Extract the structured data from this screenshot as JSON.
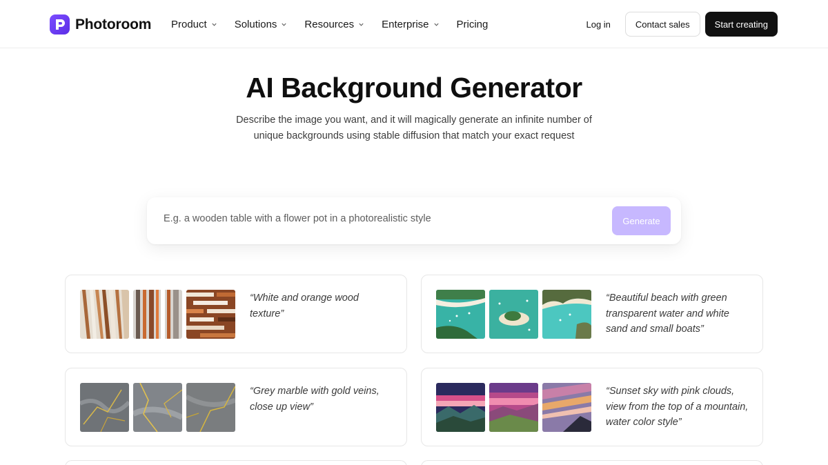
{
  "nav": {
    "brand": "Photoroom",
    "menu": [
      "Product",
      "Solutions",
      "Resources",
      "Enterprise",
      "Pricing"
    ],
    "login": "Log in",
    "contact": "Contact sales",
    "cta": "Start creating",
    "accent": "#6a3df0"
  },
  "hero": {
    "title": "AI Background Generator",
    "subtitle": "Describe the image you want, and it will magically generate an infinite number of unique backgrounds using stable diffusion that match your exact request"
  },
  "search": {
    "placeholder": "E.g. a wooden table with a flower pot in a photorealistic style",
    "button": "Generate",
    "button_color": "#c7b8ff"
  },
  "examples": [
    {
      "caption": "“White and orange wood texture”",
      "theme": "wood"
    },
    {
      "caption": "“Beautiful beach with green transparent water and white sand and small boats”",
      "theme": "beach"
    },
    {
      "caption": "“Grey marble with gold veins, close up view”",
      "theme": "marble"
    },
    {
      "caption": "“Sunset sky with pink clouds, view from the top of a mountain, water color style”",
      "theme": "sunset"
    }
  ]
}
